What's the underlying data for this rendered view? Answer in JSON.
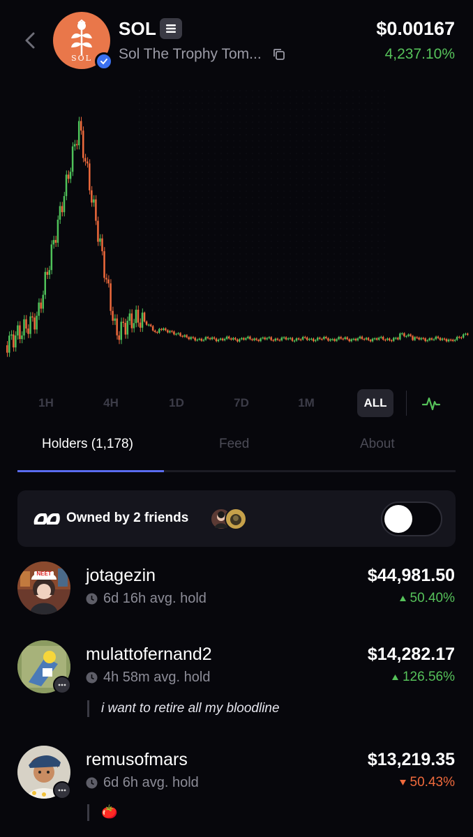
{
  "header": {
    "ticker": "SOL",
    "token_name": "Sol The Trophy Tom...",
    "logo_text": "SOL",
    "price": "$0.00167",
    "change": "4,237.10%"
  },
  "ranges": [
    "1H",
    "4H",
    "1D",
    "7D",
    "1M",
    "ALL"
  ],
  "active_range": "ALL",
  "tabs": {
    "holders": "Holders (1,178)",
    "feed": "Feed",
    "about": "About"
  },
  "friends": {
    "label": "Owned by 2 friends",
    "toggle_on": false
  },
  "holders": [
    {
      "username": "jotagezin",
      "hold": "6d 16h avg. hold",
      "value": "$44,981.50",
      "pct": "50.40%",
      "direction": "up",
      "avatar_cap_text": "NEET",
      "comment": ""
    },
    {
      "username": "mulattofernand2",
      "hold": "4h 58m avg. hold",
      "value": "$14,282.17",
      "pct": "126.56%",
      "direction": "up",
      "comment": "i want to retire all my bloodline"
    },
    {
      "username": "remusofmars",
      "hold": "6d 6h avg. hold",
      "value": "$13,219.35",
      "pct": "50.43%",
      "direction": "down",
      "comment": "🍅"
    }
  ],
  "colors": {
    "background": "#07070c",
    "up": "#56c25a",
    "down": "#ef6a3c",
    "accent": "#5a6cf0",
    "logo": "#e9774a"
  }
}
